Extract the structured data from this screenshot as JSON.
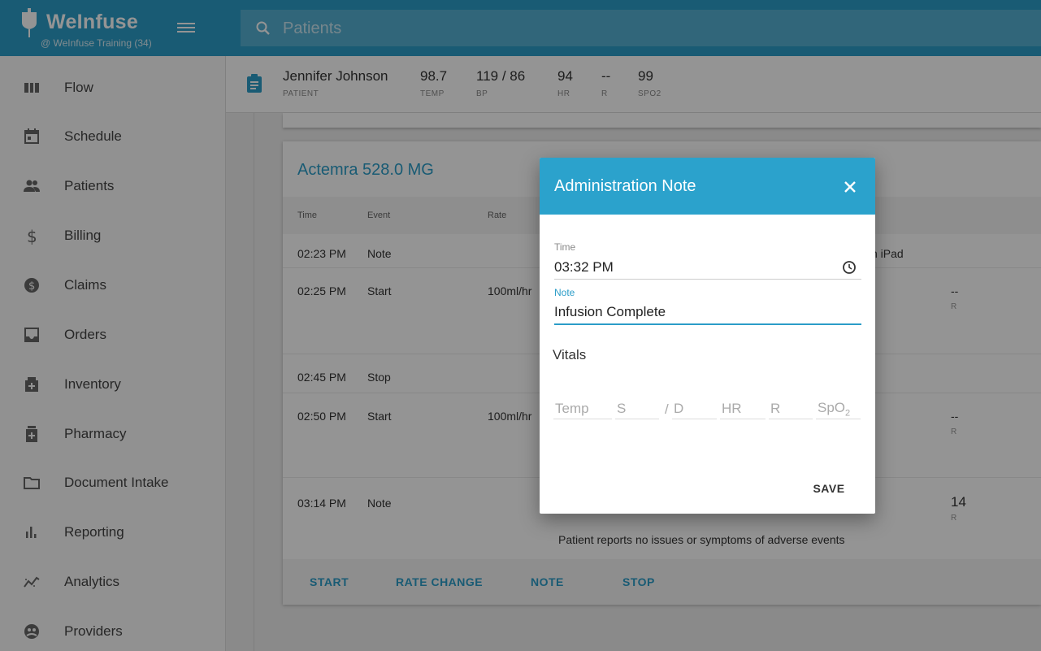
{
  "app": {
    "name": "WeInfuse",
    "account": "@ WeInfuse Training (34)"
  },
  "search": {
    "placeholder": "Patients"
  },
  "sidebar": {
    "items": [
      {
        "label": "Flow",
        "icon": "flow-icon"
      },
      {
        "label": "Schedule",
        "icon": "calendar-icon"
      },
      {
        "label": "Patients",
        "icon": "people-icon"
      },
      {
        "label": "Billing",
        "icon": "dollar-icon"
      },
      {
        "label": "Claims",
        "icon": "coin-icon"
      },
      {
        "label": "Orders",
        "icon": "inbox-icon"
      },
      {
        "label": "Inventory",
        "icon": "inventory-icon"
      },
      {
        "label": "Pharmacy",
        "icon": "pill-bottle-icon"
      },
      {
        "label": "Document Intake",
        "icon": "folder-icon"
      },
      {
        "label": "Reporting",
        "icon": "bar-chart-icon"
      },
      {
        "label": "Analytics",
        "icon": "trend-icon"
      },
      {
        "label": "Providers",
        "icon": "provider-icon"
      }
    ]
  },
  "patient_bar": {
    "name": "Jennifer Johnson",
    "name_label": "PATIENT",
    "vitals": [
      {
        "value": "98.7",
        "label": "TEMP"
      },
      {
        "value": "119 / 86",
        "label": "BP"
      },
      {
        "value": "94",
        "label": "HR"
      },
      {
        "value": "--",
        "label": "R"
      },
      {
        "value": "99",
        "label": "SPO2"
      }
    ]
  },
  "card": {
    "title": "Actemra 528.0 MG",
    "columns": [
      "Time",
      "Event",
      "Rate"
    ],
    "rows": [
      {
        "time": "02:23 PM",
        "event": "Note",
        "rate": "",
        "extra": "n iPad"
      },
      {
        "time": "02:25 PM",
        "event": "Start",
        "rate": "100ml/hr",
        "r_value": "--",
        "r_label": "R"
      },
      {
        "time": "02:45 PM",
        "event": "Stop",
        "rate": ""
      },
      {
        "time": "02:50 PM",
        "event": "Start",
        "rate": "100ml/hr",
        "r_value": "--",
        "r_label": "R"
      },
      {
        "time": "03:14 PM",
        "event": "Note",
        "rate": "",
        "r_value": "14",
        "r_label": "R",
        "note": "Patient reports no issues or symptoms of adverse events"
      }
    ],
    "actions": [
      "START",
      "RATE CHANGE",
      "NOTE",
      "STOP"
    ]
  },
  "dialog": {
    "title": "Administration Note",
    "time_label": "Time",
    "time_value": "03:32 PM",
    "note_label": "Note",
    "note_value": "Infusion Complete",
    "vitals_title": "Vitals",
    "vitals_placeholders": {
      "temp": "Temp",
      "systolic": "S",
      "slash": "/",
      "diastolic": "D",
      "hr": "HR",
      "r": "R",
      "spo2": "SpO"
    },
    "spo2_subscript": "2",
    "save_label": "SAVE"
  },
  "colors": {
    "primary": "#2b9dc8",
    "dialog_header": "#2ba2cc"
  }
}
